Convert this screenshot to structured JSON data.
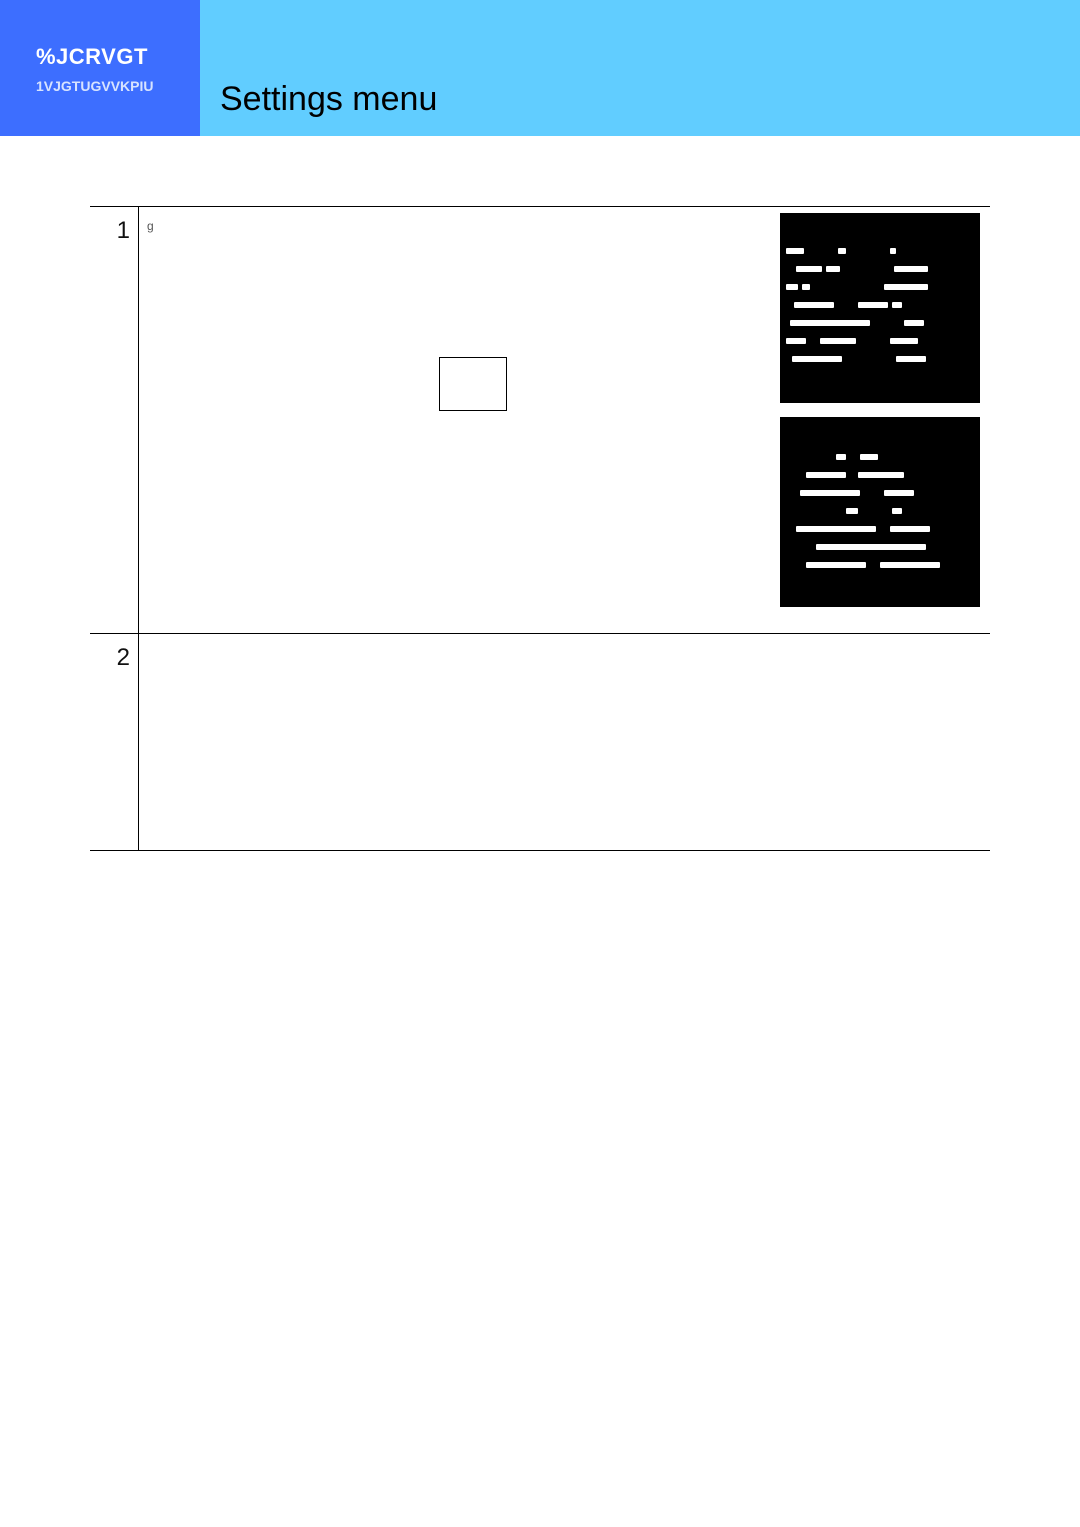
{
  "banner": {
    "chapter_label": "%JCRVGT",
    "chapter_sub": "1VJGTUGVVKPIU",
    "title": "Settings menu"
  },
  "steps": [
    {
      "number": "1",
      "text": "g",
      "faint_label": "",
      "thumbnails": 2
    },
    {
      "number": "2",
      "text": "",
      "thumbnails": 0
    }
  ]
}
